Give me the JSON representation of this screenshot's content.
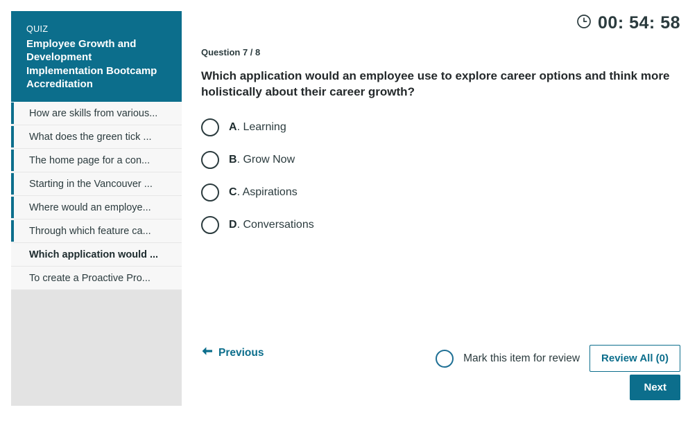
{
  "sidebar": {
    "kicker": "QUIZ",
    "title": "Employee Growth and Development Implementation Bootcamp Accreditation",
    "accent_color": "#0c6e8c",
    "items": [
      {
        "label": "How are skills from various...",
        "answered": true,
        "current": false
      },
      {
        "label": "What does the green tick ...",
        "answered": true,
        "current": false
      },
      {
        "label": "The home page for a con...",
        "answered": true,
        "current": false
      },
      {
        "label": "Starting in the Vancouver ...",
        "answered": true,
        "current": false
      },
      {
        "label": "Where would an employe...",
        "answered": true,
        "current": false
      },
      {
        "label": "Through which feature ca...",
        "answered": true,
        "current": false
      },
      {
        "label": "Which application would ...",
        "answered": false,
        "current": true
      },
      {
        "label": "To create a Proactive Pro...",
        "answered": false,
        "current": false
      }
    ]
  },
  "timer": {
    "icon": "clock-icon",
    "value": "00: 54: 58"
  },
  "question": {
    "meta": "Question 7 / 8",
    "text": "Which application would an employee use to explore career options and think more holistically about their career growth?",
    "options": [
      {
        "letter": "A",
        "separator": ". ",
        "text": "Learning"
      },
      {
        "letter": "B",
        "separator": ". ",
        "text": "Grow Now"
      },
      {
        "letter": "C",
        "separator": ". ",
        "text": "Aspirations"
      },
      {
        "letter": "D",
        "separator": ". ",
        "text": "Conversations"
      }
    ]
  },
  "footer": {
    "previous_label": "Previous",
    "previous_icon": "arrow-left-icon",
    "mark_review_label": "Mark this item for review",
    "review_all_label": "Review All (0)",
    "next_label": "Next"
  }
}
